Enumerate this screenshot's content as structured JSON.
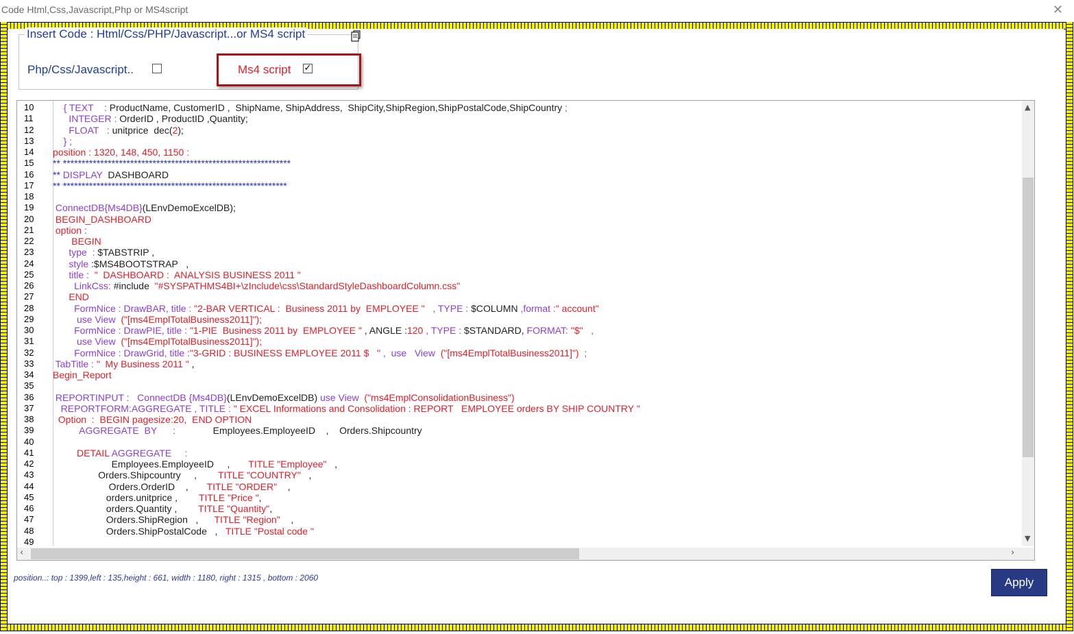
{
  "window": {
    "title": "Code Html,Css,Javascript,Php or MS4script",
    "close_glyph": "✕"
  },
  "group": {
    "legend": "Insert Code : Html/Css/PHP/Javascript...or MS4 script",
    "option_php_label": "Php/Css/Javascript..",
    "option_php_checked": false,
    "option_ms4_label": "Ms4 script",
    "option_ms4_checked": true,
    "check_glyph": "✓"
  },
  "colors": {
    "keyword": "#8a3fd6",
    "string": "#e0202a",
    "text": "#1f1f1f",
    "comment": "#2233cc",
    "highlight_box": "#a4151a",
    "apply_button": "#283a84",
    "ruler": "#f5f500"
  },
  "editor": {
    "lines": [
      {
        "n": "10",
        "segs": [
          [
            "b",
            "    "
          ],
          [
            "k",
            "{ TEXT    : "
          ],
          [
            "b",
            "ProductName, CustomerID ,  ShipName, ShipAddress,  ShipCity,ShipRegion,ShipPostalCode,ShipCountry "
          ],
          [
            "k",
            ";"
          ]
        ]
      },
      {
        "n": "11",
        "segs": [
          [
            "b",
            "      "
          ],
          [
            "k",
            "INTEGER : "
          ],
          [
            "b",
            "OrderID , ProductID ,Quantity;"
          ]
        ]
      },
      {
        "n": "12",
        "segs": [
          [
            "b",
            "      "
          ],
          [
            "k",
            "FLOAT   : "
          ],
          [
            "b",
            "unitprice  dec("
          ],
          [
            "r",
            "2"
          ],
          [
            "b",
            ");"
          ]
        ]
      },
      {
        "n": "13",
        "segs": [
          [
            "b",
            "    "
          ],
          [
            "k",
            "} ;"
          ]
        ]
      },
      {
        "n": "14",
        "segs": [
          [
            "r",
            "position : 1320, 148, 450, 1150 :"
          ]
        ]
      },
      {
        "n": "15",
        "segs": [
          [
            "bl",
            "** *************************************************************"
          ]
        ]
      },
      {
        "n": "16",
        "segs": [
          [
            "bl",
            "** "
          ],
          [
            "k",
            "DISPLAY  "
          ],
          [
            "b",
            "DASHBOARD"
          ]
        ]
      },
      {
        "n": "17",
        "segs": [
          [
            "bl",
            "** ************************************************************"
          ]
        ]
      },
      {
        "n": "18",
        "segs": [
          [
            "b",
            ""
          ]
        ]
      },
      {
        "n": "19",
        "segs": [
          [
            "b",
            " "
          ],
          [
            "k",
            "ConnectDB{Ms4DB}"
          ],
          [
            "b",
            "(LEnvDemoExcelDB);"
          ]
        ]
      },
      {
        "n": "20",
        "segs": [
          [
            "r",
            " BEGIN_DASHBOARD"
          ]
        ]
      },
      {
        "n": "21",
        "segs": [
          [
            "r",
            " option :"
          ]
        ]
      },
      {
        "n": "22",
        "segs": [
          [
            "r",
            "       BEGIN"
          ]
        ]
      },
      {
        "n": "23",
        "segs": [
          [
            "k",
            "      type  : "
          ],
          [
            "b",
            "$TABSTRIP ,"
          ]
        ]
      },
      {
        "n": "24",
        "segs": [
          [
            "k",
            "      style "
          ],
          [
            "b",
            ":$MS4BOOTSTRAP   ,"
          ]
        ]
      },
      {
        "n": "25",
        "segs": [
          [
            "k",
            "      title :  "
          ],
          [
            "r",
            "\"  DASHBOARD :  ANALYSIS BUSINESS 2011 \""
          ]
        ]
      },
      {
        "n": "26",
        "segs": [
          [
            "k",
            "        LinkCss: "
          ],
          [
            "b",
            "#include  "
          ],
          [
            "r",
            "\"#SYSPATHMS4BI+\\zInclude\\css\\StandardStyleDashboardColumn.css\""
          ]
        ]
      },
      {
        "n": "27",
        "segs": [
          [
            "r",
            "      END"
          ]
        ]
      },
      {
        "n": "28",
        "segs": [
          [
            "k",
            "        FormNice : DrawBAR, title : "
          ],
          [
            "r",
            "\"2-BAR VERTICAL :  Business 2011 by  EMPLOYEE \""
          ],
          [
            "k",
            "   , TYPE : "
          ],
          [
            "b",
            "$COLUMN "
          ],
          [
            "k",
            ",format :"
          ],
          [
            "r",
            "\" account\""
          ]
        ]
      },
      {
        "n": "29",
        "segs": [
          [
            "k",
            "         use View  "
          ],
          [
            "r",
            "(\"[ms4EmplTotalBusiness2011]\");"
          ]
        ]
      },
      {
        "n": "30",
        "segs": [
          [
            "k",
            "        FormNice : DrawPIE, title : "
          ],
          [
            "r",
            "\"1-PIE  Business 2011 by  EMPLOYEE \""
          ],
          [
            "b",
            " , ANGLE :"
          ],
          [
            "r",
            "120"
          ],
          [
            "k",
            " , TYPE : "
          ],
          [
            "b",
            "$STANDARD, "
          ],
          [
            "k",
            "FORMAT: "
          ],
          [
            "r",
            "\"$\""
          ],
          [
            "k",
            "   ,"
          ]
        ]
      },
      {
        "n": "31",
        "segs": [
          [
            "k",
            "         use View  "
          ],
          [
            "r",
            "(\"[ms4EmplTotalBusiness2011]\");"
          ]
        ]
      },
      {
        "n": "32",
        "segs": [
          [
            "k",
            "        FormNice : DrawGrid, title :"
          ],
          [
            "r",
            "\"3-GRID : BUSINESS EMPLOYEE 2011 $   \""
          ],
          [
            "k",
            " ,  use   View  "
          ],
          [
            "r",
            "(\"[ms4EmplTotalBusiness2011]\")"
          ],
          [
            "k",
            "  ;"
          ]
        ]
      },
      {
        "n": "33",
        "segs": [
          [
            "k",
            " TabTitle : "
          ],
          [
            "r",
            "\"  My Business 2011 \""
          ],
          [
            "b",
            " ,"
          ]
        ]
      },
      {
        "n": "34",
        "segs": [
          [
            "r",
            "Begin_Report"
          ]
        ]
      },
      {
        "n": "35",
        "segs": [
          [
            "b",
            ""
          ]
        ]
      },
      {
        "n": "36",
        "segs": [
          [
            "k",
            " REPORTINPUT :   ConnectDB {Ms4DB}"
          ],
          [
            "b",
            "(LEnvDemoExcelDB) "
          ],
          [
            "k",
            "use View  "
          ],
          [
            "r",
            "(\"ms4EmplConsolidationBusiness\")"
          ]
        ]
      },
      {
        "n": "37",
        "segs": [
          [
            "k",
            "   REPORTFORM:AGGREGATE , TITLE : "
          ],
          [
            "r",
            "\" EXCEL Informations and Consolidation : REPORT   EMPLOYEE orders BY SHIP COUNTRY \""
          ]
        ]
      },
      {
        "n": "38",
        "segs": [
          [
            "r",
            "  Option  :  BEGIN pagesize:20,  END OPTION"
          ]
        ]
      },
      {
        "n": "39",
        "segs": [
          [
            "k",
            "          AGGREGATE  BY      :              "
          ],
          [
            "b",
            "Employees.EmployeeID    ,    Orders.Shipcountry"
          ]
        ]
      },
      {
        "n": "40",
        "segs": [
          [
            "b",
            ""
          ]
        ]
      },
      {
        "n": "41",
        "segs": [
          [
            "r",
            "         DETAIL "
          ],
          [
            "k",
            "AGGREGATE     :"
          ]
        ]
      },
      {
        "n": "42",
        "segs": [
          [
            "b",
            "                      Employees.EmployeeID     ,       "
          ],
          [
            "r",
            "TITLE \"Employee\""
          ],
          [
            "b",
            "   ,"
          ]
        ]
      },
      {
        "n": "43",
        "segs": [
          [
            "b",
            "                 Orders.Shipcountry     ,        "
          ],
          [
            "r",
            "TITLE \"COUNTRY\""
          ],
          [
            "b",
            "   ,"
          ]
        ]
      },
      {
        "n": "44",
        "segs": [
          [
            "b",
            "                     Orders.OrderID    ,       "
          ],
          [
            "r",
            "TITLE \"ORDER\""
          ],
          [
            "b",
            "    ,"
          ]
        ]
      },
      {
        "n": "45",
        "segs": [
          [
            "b",
            "                    orders.unitprice ,        "
          ],
          [
            "r",
            "TITLE \"Price \""
          ],
          [
            "b",
            ","
          ]
        ]
      },
      {
        "n": "46",
        "segs": [
          [
            "b",
            "                    orders.Quantity ,        "
          ],
          [
            "r",
            "TITLE \"Quantity\""
          ],
          [
            "b",
            ","
          ]
        ]
      },
      {
        "n": "47",
        "segs": [
          [
            "b",
            "                    Orders.ShipRegion   ,      "
          ],
          [
            "r",
            "TITLE \"Region\""
          ],
          [
            "b",
            "    ,"
          ]
        ]
      },
      {
        "n": "48",
        "segs": [
          [
            "b",
            "                    Orders.ShipPostalCode   ,   "
          ],
          [
            "r",
            "TITLE \"Postal code \""
          ]
        ]
      },
      {
        "n": "49",
        "segs": [
          [
            "b",
            ""
          ]
        ]
      }
    ]
  },
  "status": "position..:   top : 1399,left : 135,height : 661, width  : 1180, right : 1315 , bottom : 2060",
  "apply_label": "Apply"
}
